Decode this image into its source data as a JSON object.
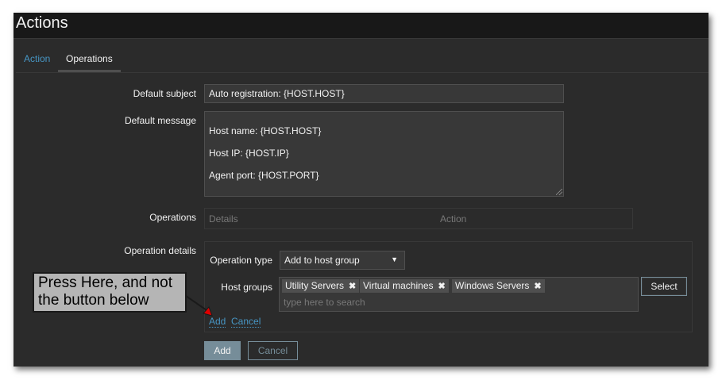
{
  "header": {
    "title": "Actions"
  },
  "tabs": [
    {
      "label": "Action"
    },
    {
      "label": "Operations"
    }
  ],
  "form": {
    "default_subject_label": "Default subject",
    "default_subject_value": "Auto registration: {HOST.HOST}",
    "default_message_label": "Default message",
    "default_message_lines": [
      "Host name: {HOST.HOST}",
      "Host IP: {HOST.IP}",
      "Agent port: {HOST.PORT}"
    ],
    "operations_label": "Operations",
    "operations_columns": [
      "Details",
      "Action"
    ],
    "operation_details_label": "Operation details"
  },
  "operation_details": {
    "type_label": "Operation type",
    "type_value": "Add to host group",
    "host_groups_label": "Host groups",
    "host_groups": [
      "Utility Servers",
      "Virtual machines",
      "Windows Servers"
    ],
    "search_placeholder": "type here to search",
    "select_label": "Select",
    "add_link": "Add",
    "cancel_link": "Cancel"
  },
  "footer_buttons": {
    "add": "Add",
    "cancel": "Cancel"
  },
  "annotation": {
    "line1": "Press Here, and not",
    "line2": "the button below"
  },
  "colors": {
    "accent": "#4796c4",
    "button": "#768d99",
    "background": "#2b2b2b",
    "annotation_arrow": "#e00000"
  }
}
